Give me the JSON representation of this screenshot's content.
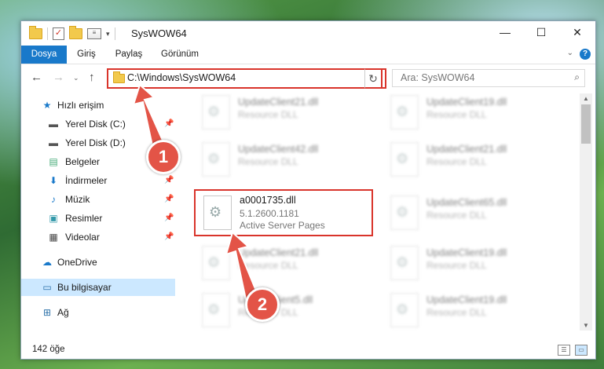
{
  "window": {
    "title": "SysWOW64"
  },
  "controls": {
    "minimize": "—",
    "maximize": "☐",
    "close": "✕"
  },
  "ribbon": {
    "tabs": [
      "Dosya",
      "Giriş",
      "Paylaş",
      "Görünüm"
    ],
    "help": "?"
  },
  "address": {
    "path": "C:\\Windows\\SysWOW64",
    "search_placeholder": "Ara: SysWOW64"
  },
  "sidebar": {
    "items": [
      {
        "label": "Hızlı erişim",
        "icon": "star-icon"
      },
      {
        "label": "Yerel Disk (C:)",
        "icon": "drive-icon",
        "pinned": true
      },
      {
        "label": "Yerel Disk (D:)",
        "icon": "drive-icon"
      },
      {
        "label": "Belgeler",
        "icon": "document-icon",
        "pinned": true
      },
      {
        "label": "İndirmeler",
        "icon": "download-icon",
        "pinned": true
      },
      {
        "label": "Müzik",
        "icon": "music-icon",
        "pinned": true
      },
      {
        "label": "Resimler",
        "icon": "picture-icon",
        "pinned": true
      },
      {
        "label": "Videolar",
        "icon": "video-icon",
        "pinned": true
      },
      {
        "label": "OneDrive",
        "icon": "cloud-icon"
      },
      {
        "label": "Bu bilgisayar",
        "icon": "computer-icon",
        "selected": true
      },
      {
        "label": "Ağ",
        "icon": "network-icon"
      }
    ]
  },
  "files": [
    {
      "name": "UpdateClient21.dll",
      "desc": "Resource DLL"
    },
    {
      "name": "UpdateClient19.dll",
      "desc": "Resource DLL"
    },
    {
      "name": "UpdateClient42.dll",
      "desc": "Resource DLL"
    },
    {
      "name": "UpdateClient21.dll",
      "desc": "Resource DLL"
    },
    {
      "name": "a0001735.dll",
      "version": "5.1.2600.1181",
      "desc": "Active Server Pages",
      "highlighted": true
    },
    {
      "name": "UpdateClient65.dll",
      "desc": "Resource DLL"
    },
    {
      "name": "UpdateClient21.dll",
      "desc": "Resource DLL"
    },
    {
      "name": "UpdateClient19.dll",
      "desc": "Resource DLL"
    },
    {
      "name": "UpdateClient5.dll",
      "desc": "Resource DLL"
    },
    {
      "name": "UpdateClient19.dll",
      "desc": "Resource DLL"
    }
  ],
  "status": {
    "count": "142 öğe"
  },
  "annotations": {
    "step1": "1",
    "step2": "2"
  },
  "colors": {
    "accent": "#1979ca",
    "highlight": "#d9342b",
    "badge": "#e35447"
  }
}
